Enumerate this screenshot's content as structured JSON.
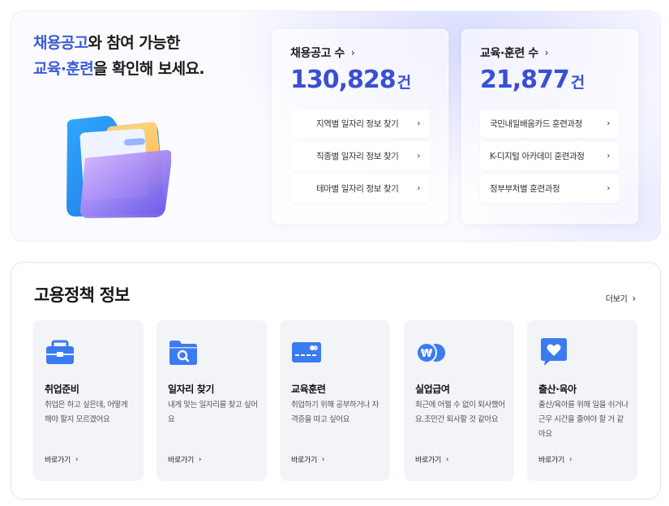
{
  "hero": {
    "title_line1_accent": "채용공고",
    "title_line1_rest": "와 참여 가능한",
    "title_line2_accent": "교육·훈련",
    "title_line2_rest": "을 확인해 보세요."
  },
  "jobs": {
    "label": "채용공고 수",
    "count": "130,828",
    "unit": "건",
    "links": [
      "지역별 일자리 정보 찾기",
      "직종별 일자리 정보 찾기",
      "테마별 일자리 정보 찾기"
    ]
  },
  "education": {
    "label": "교육·훈련 수",
    "count": "21,877",
    "unit": "건",
    "links": [
      "국민내일배움카드 훈련과정",
      "K-디지털 아카데미 훈련과정",
      "정부부처별 훈련과정"
    ]
  },
  "policy": {
    "title": "고용정책 정보",
    "more_label": "더보기",
    "go_label": "바로가기",
    "cards": [
      {
        "title": "취업준비",
        "desc": "취업은 하고 싶은데, 어떻게 해야 할지 모르겠어요",
        "icon": "briefcase-icon"
      },
      {
        "title": "일자리 찾기",
        "desc": "내게 맞는 일자리를 찾고 싶어요",
        "icon": "folder-search-icon"
      },
      {
        "title": "교육훈련",
        "desc": "취업하기 위해 공부하거나 자격증을 따고 싶어요",
        "icon": "card-icon"
      },
      {
        "title": "실업급여",
        "desc": "최근에 어쩔 수 없이 퇴사했어요.조만간 퇴사할 것 같아요",
        "icon": "won-coin-icon"
      },
      {
        "title": "출산·육아",
        "desc": "출산/육아를 위해 일을 쉬거나 근무 시간을 줄여야 할 거 같아요",
        "icon": "heart-chat-icon"
      }
    ]
  },
  "colors": {
    "accent": "#3a5bd9",
    "stat_number": "#3a4fd2",
    "icon_blue": "#3b7bf0"
  }
}
